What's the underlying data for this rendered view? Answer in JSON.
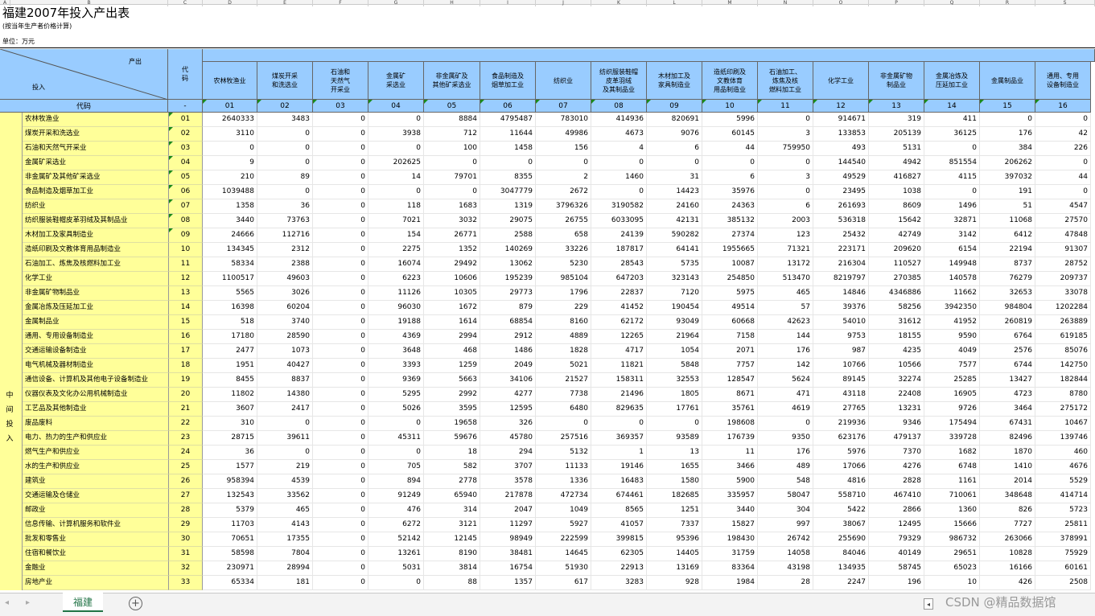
{
  "title": "福建2007年投入产出表",
  "subtitle": "(按当年生产者价格计算)",
  "unit": "单位：万元",
  "col_letters": [
    "A",
    "B",
    "C",
    "D",
    "E",
    "F",
    "G",
    "H",
    "I",
    "J",
    "K",
    "L",
    "M",
    "N",
    "O",
    "P",
    "Q",
    "R",
    "S"
  ],
  "header": {
    "output_label": "产出",
    "input_label": "投入",
    "code_label": "代码",
    "code_row_label": "代码",
    "code_row_dash": "-"
  },
  "row_group_label": [
    "中",
    "间",
    "投",
    "入"
  ],
  "columns": [
    {
      "name": "农林牧渔业",
      "code": "01"
    },
    {
      "name": "煤炭开采\n和洗选业",
      "code": "02"
    },
    {
      "name": "石油和\n天然气\n开采业",
      "code": "03"
    },
    {
      "name": "金属矿\n采选业",
      "code": "04"
    },
    {
      "name": "非金属矿及\n其他矿采选业",
      "code": "05"
    },
    {
      "name": "食品制造及\n烟草加工业",
      "code": "06"
    },
    {
      "name": "纺织业",
      "code": "07"
    },
    {
      "name": "纺织服装鞋帽\n皮革羽绒\n及其制品业",
      "code": "08"
    },
    {
      "name": "木材加工及\n家具制造业",
      "code": "09"
    },
    {
      "name": "造纸印刷及\n文教体育\n用品制造业",
      "code": "10"
    },
    {
      "name": "石油加工、\n炼焦及核\n燃料加工业",
      "code": "11"
    },
    {
      "name": "化学工业",
      "code": "12"
    },
    {
      "name": "非金属矿物\n制品业",
      "code": "13"
    },
    {
      "name": "金属冶炼及\n压延加工业",
      "code": "14"
    },
    {
      "name": "金属制品业",
      "code": "15"
    },
    {
      "name": "通用、专用\n设备制造业",
      "code": "16"
    }
  ],
  "rows": [
    {
      "label": "农林牧渔业",
      "code": "01",
      "values": [
        "2640333",
        "3483",
        "0",
        "0",
        "8884",
        "4795487",
        "783010",
        "414936",
        "820691",
        "5996",
        "0",
        "914671",
        "319",
        "411",
        "0",
        "0"
      ]
    },
    {
      "label": "煤炭开采和洗选业",
      "code": "02",
      "values": [
        "3110",
        "0",
        "0",
        "3938",
        "712",
        "11644",
        "49986",
        "4673",
        "9076",
        "60145",
        "3",
        "133853",
        "205139",
        "36125",
        "176",
        "42"
      ]
    },
    {
      "label": "石油和天然气开采业",
      "code": "03",
      "values": [
        "0",
        "0",
        "0",
        "0",
        "100",
        "1458",
        "156",
        "4",
        "6",
        "44",
        "759950",
        "493",
        "5131",
        "0",
        "384",
        "226"
      ]
    },
    {
      "label": "金属矿采选业",
      "code": "04",
      "values": [
        "9",
        "0",
        "0",
        "202625",
        "0",
        "0",
        "0",
        "0",
        "0",
        "0",
        "0",
        "144540",
        "4942",
        "851554",
        "206262",
        "0"
      ]
    },
    {
      "label": "非金属矿及其他矿采选业",
      "code": "05",
      "values": [
        "210",
        "89",
        "0",
        "14",
        "79701",
        "8355",
        "2",
        "1460",
        "31",
        "6",
        "3",
        "49529",
        "416827",
        "4115",
        "397032",
        "44"
      ]
    },
    {
      "label": "食品制造及烟草加工业",
      "code": "06",
      "values": [
        "1039488",
        "0",
        "0",
        "0",
        "0",
        "3047779",
        "2672",
        "0",
        "14423",
        "35976",
        "0",
        "23495",
        "1038",
        "0",
        "191",
        "0"
      ]
    },
    {
      "label": "纺织业",
      "code": "07",
      "values": [
        "1358",
        "36",
        "0",
        "118",
        "1683",
        "1319",
        "3796326",
        "3190582",
        "24160",
        "24363",
        "6",
        "261693",
        "8609",
        "1496",
        "51",
        "4547"
      ]
    },
    {
      "label": "纺织服装鞋帽皮革羽绒及其制品业",
      "code": "08",
      "values": [
        "3440",
        "73763",
        "0",
        "7021",
        "3032",
        "29075",
        "26755",
        "6033095",
        "42131",
        "385132",
        "2003",
        "536318",
        "15642",
        "32871",
        "11068",
        "27570"
      ]
    },
    {
      "label": "木材加工及家具制造业",
      "code": "09",
      "values": [
        "24666",
        "112716",
        "0",
        "154",
        "26771",
        "2588",
        "658",
        "24139",
        "590282",
        "27374",
        "123",
        "25432",
        "42749",
        "3142",
        "6412",
        "47848"
      ]
    },
    {
      "label": "造纸印刷及文教体育用品制造业",
      "code": "10",
      "values": [
        "134345",
        "2312",
        "0",
        "2275",
        "1352",
        "140269",
        "33226",
        "187817",
        "64141",
        "1955665",
        "71321",
        "223171",
        "209620",
        "6154",
        "22194",
        "91307"
      ]
    },
    {
      "label": "石油加工、炼焦及核燃料加工业",
      "code": "11",
      "values": [
        "58334",
        "2388",
        "0",
        "16074",
        "29492",
        "13062",
        "5230",
        "28543",
        "5735",
        "10087",
        "13172",
        "216304",
        "110527",
        "149948",
        "8737",
        "28752"
      ]
    },
    {
      "label": "化学工业",
      "code": "12",
      "values": [
        "1100517",
        "49603",
        "0",
        "6223",
        "10606",
        "195239",
        "985104",
        "647203",
        "323143",
        "254850",
        "513470",
        "8219797",
        "270385",
        "140578",
        "76279",
        "209737"
      ]
    },
    {
      "label": "非金属矿物制品业",
      "code": "13",
      "values": [
        "5565",
        "3026",
        "0",
        "11126",
        "10305",
        "29773",
        "1796",
        "22837",
        "7120",
        "5975",
        "465",
        "14846",
        "4346886",
        "11662",
        "32653",
        "33078"
      ]
    },
    {
      "label": "金属冶炼及压延加工业",
      "code": "14",
      "values": [
        "16398",
        "60204",
        "0",
        "96030",
        "1672",
        "879",
        "229",
        "41452",
        "190454",
        "49514",
        "57",
        "39376",
        "58256",
        "3942350",
        "984804",
        "1202284"
      ]
    },
    {
      "label": "金属制品业",
      "code": "15",
      "values": [
        "518",
        "3740",
        "0",
        "19188",
        "1614",
        "68854",
        "8160",
        "62172",
        "93049",
        "60668",
        "42623",
        "54010",
        "31612",
        "41952",
        "260819",
        "263889"
      ]
    },
    {
      "label": "通用、专用设备制造业",
      "code": "16",
      "values": [
        "17180",
        "28590",
        "0",
        "4369",
        "2994",
        "2912",
        "4889",
        "12265",
        "21964",
        "7158",
        "144",
        "9753",
        "18155",
        "9590",
        "6764",
        "619185"
      ]
    },
    {
      "label": "交通运输设备制造业",
      "code": "17",
      "values": [
        "2477",
        "1073",
        "0",
        "3648",
        "468",
        "1486",
        "1828",
        "4717",
        "1054",
        "2071",
        "176",
        "987",
        "4235",
        "4049",
        "2576",
        "85076"
      ]
    },
    {
      "label": "电气机械及器材制造业",
      "code": "18",
      "values": [
        "1951",
        "40427",
        "0",
        "3393",
        "1259",
        "2049",
        "5021",
        "11821",
        "5848",
        "7757",
        "142",
        "10766",
        "10566",
        "7577",
        "6744",
        "142750"
      ]
    },
    {
      "label": "通信设备、计算机及其他电子设备制造业",
      "code": "19",
      "values": [
        "8455",
        "8837",
        "0",
        "9369",
        "5663",
        "34106",
        "21527",
        "158311",
        "32553",
        "128547",
        "5624",
        "89145",
        "32274",
        "25285",
        "13427",
        "182844"
      ]
    },
    {
      "label": "仪器仪表及文化办公用机械制造业",
      "code": "20",
      "values": [
        "11802",
        "14380",
        "0",
        "5295",
        "2992",
        "4277",
        "7738",
        "21496",
        "1805",
        "8671",
        "471",
        "43118",
        "22408",
        "16905",
        "4723",
        "8780"
      ]
    },
    {
      "label": "工艺品及其他制造业",
      "code": "21",
      "values": [
        "3607",
        "2417",
        "0",
        "5026",
        "3595",
        "12595",
        "6480",
        "829635",
        "17761",
        "35761",
        "4619",
        "27765",
        "13231",
        "9726",
        "3464",
        "275172"
      ]
    },
    {
      "label": "废品废料",
      "code": "22",
      "values": [
        "310",
        "0",
        "0",
        "0",
        "19658",
        "326",
        "0",
        "0",
        "0",
        "198608",
        "0",
        "219936",
        "9346",
        "175494",
        "67431",
        "10467"
      ]
    },
    {
      "label": "电力、热力的生产和供应业",
      "code": "23",
      "values": [
        "28715",
        "39611",
        "0",
        "45311",
        "59676",
        "45780",
        "257516",
        "369357",
        "93589",
        "176739",
        "9350",
        "623176",
        "479137",
        "339728",
        "82496",
        "139746"
      ]
    },
    {
      "label": "燃气生产和供应业",
      "code": "24",
      "values": [
        "36",
        "0",
        "0",
        "0",
        "18",
        "294",
        "5132",
        "1",
        "13",
        "11",
        "176",
        "5976",
        "7370",
        "1682",
        "1870",
        "460"
      ]
    },
    {
      "label": "水的生产和供应业",
      "code": "25",
      "values": [
        "1577",
        "219",
        "0",
        "705",
        "582",
        "3707",
        "11133",
        "19146",
        "1655",
        "3466",
        "489",
        "17066",
        "4276",
        "6748",
        "1410",
        "4676"
      ]
    },
    {
      "label": "建筑业",
      "code": "26",
      "values": [
        "958394",
        "4539",
        "0",
        "894",
        "2778",
        "3578",
        "1336",
        "16483",
        "1580",
        "5900",
        "548",
        "4816",
        "2828",
        "1161",
        "2014",
        "5529"
      ]
    },
    {
      "label": "交通运输及仓储业",
      "code": "27",
      "values": [
        "132543",
        "33562",
        "0",
        "91249",
        "65940",
        "217878",
        "472734",
        "674461",
        "182685",
        "335957",
        "58047",
        "558710",
        "467410",
        "710061",
        "348648",
        "414714"
      ]
    },
    {
      "label": "邮政业",
      "code": "28",
      "values": [
        "5379",
        "465",
        "0",
        "476",
        "314",
        "2047",
        "1049",
        "8565",
        "1251",
        "3440",
        "304",
        "5422",
        "2866",
        "1360",
        "826",
        "5723"
      ]
    },
    {
      "label": "信息传输、计算机服务和软件业",
      "code": "29",
      "values": [
        "11703",
        "4143",
        "0",
        "6272",
        "3121",
        "11297",
        "5927",
        "41057",
        "7337",
        "15827",
        "997",
        "38067",
        "12495",
        "15666",
        "7727",
        "25811"
      ]
    },
    {
      "label": "批发和零售业",
      "code": "30",
      "values": [
        "70651",
        "17355",
        "0",
        "52142",
        "12145",
        "98949",
        "222599",
        "399815",
        "95396",
        "198430",
        "26742",
        "255690",
        "79329",
        "986732",
        "263066",
        "378991"
      ]
    },
    {
      "label": "住宿和餐饮业",
      "code": "31",
      "values": [
        "58598",
        "7804",
        "0",
        "13261",
        "8190",
        "38481",
        "14645",
        "62305",
        "14405",
        "31759",
        "14058",
        "84046",
        "40149",
        "29651",
        "10828",
        "75929"
      ]
    },
    {
      "label": "金融业",
      "code": "32",
      "values": [
        "230971",
        "28994",
        "0",
        "5031",
        "3814",
        "16754",
        "51930",
        "22913",
        "13169",
        "83364",
        "43198",
        "134935",
        "58745",
        "65023",
        "16166",
        "60161"
      ]
    },
    {
      "label": "房地产业",
      "code": "33",
      "values": [
        "65334",
        "181",
        "0",
        "0",
        "88",
        "1357",
        "617",
        "3283",
        "928",
        "1984",
        "28",
        "2247",
        "196",
        "10",
        "426",
        "2508"
      ]
    }
  ],
  "sheet_tab": "福建",
  "add_sheet_symbol": "+",
  "nav_left": "◂",
  "nav_right": "▸",
  "scroll_left": "◂",
  "watermark": "CSDN @精品数据馆",
  "colors": {
    "header_blue": "#99ccff",
    "label_yellow": "#ffff99",
    "tab_green": "#217346"
  }
}
